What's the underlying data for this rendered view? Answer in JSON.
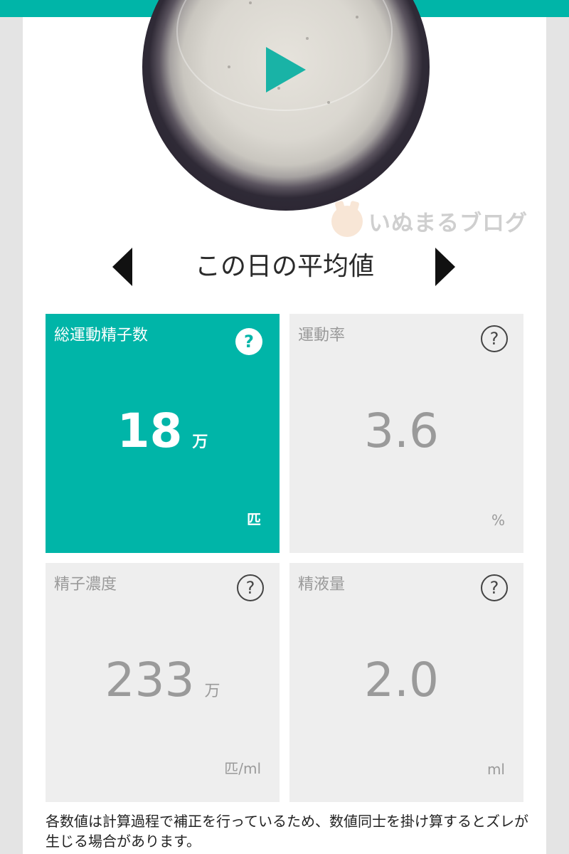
{
  "header": {
    "accent_color": "#00b5a8"
  },
  "video": {
    "play_icon": "play-icon"
  },
  "watermark": {
    "text": "いぬまるブログ"
  },
  "nav": {
    "title": "この日の平均値",
    "prev_icon": "caret-left-icon",
    "next_icon": "caret-right-icon"
  },
  "metrics": [
    {
      "label": "総運動精子数",
      "value": "18",
      "value_unit": "万",
      "unit": "匹",
      "help": "?",
      "active": true
    },
    {
      "label": "運動率",
      "value": "3.6",
      "value_unit": "",
      "unit": "%",
      "help": "?",
      "active": false
    },
    {
      "label": "精子濃度",
      "value": "233",
      "value_unit": "万",
      "unit": "匹/ml",
      "help": "?",
      "active": false
    },
    {
      "label": "精液量",
      "value": "2.0",
      "value_unit": "",
      "unit": "ml",
      "help": "?",
      "active": false
    }
  ],
  "footnote": "各数値は計算過程で補正を行っているため、数値同士を掛け算するとズレが生じる場合があります。"
}
